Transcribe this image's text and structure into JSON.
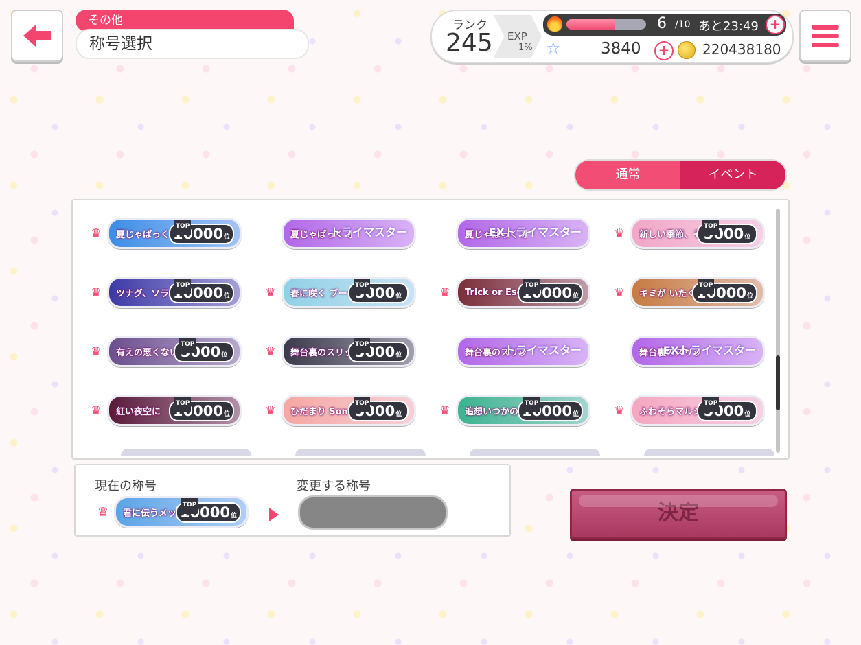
{
  "header": {
    "category": "その他",
    "title": "称号選択"
  },
  "status": {
    "rank_label": "ランク",
    "rank": "245",
    "exp_label": "EXP",
    "exp_percent": "1%",
    "exp_fraction": 0.01,
    "stamina_current": "6",
    "stamina_max": "/10",
    "stamina_timer": "あと23:49",
    "stamina_fraction": 0.6,
    "stars": "3840",
    "coins": "220438180"
  },
  "tabs": [
    "通常",
    "イベント"
  ],
  "titles": [
    {
      "name": "夏じゃぱっく 水の国",
      "rank": "10000",
      "crown": true,
      "award": "",
      "color": "#3b8de6"
    },
    {
      "name": "夏じゃぱっく 水の国",
      "rank": "",
      "crown": false,
      "award": "トライマスター",
      "color": "#b267e8"
    },
    {
      "name": "夏じゃぱっく 水の国",
      "rank": "",
      "crown": false,
      "award": "EXトライマスター",
      "color": "#b267e8"
    },
    {
      "name": "新しい季節、その前に",
      "rank": "5000",
      "crown": true,
      "award": "",
      "color": "#f2a7c6"
    },
    {
      "name": "ツナグ、ソラモヨウ",
      "rank": "10000",
      "crown": true,
      "award": "",
      "color": "#3d3aa6"
    },
    {
      "name": "春に咲く ブーケ",
      "rank": "5000",
      "crown": true,
      "award": "",
      "color": "#8fd1e6"
    },
    {
      "name": "Trick or Escape!",
      "rank": "10000",
      "crown": true,
      "award": "",
      "color": "#7a2f3a"
    },
    {
      "name": "キミが いたくらい",
      "rank": "10000",
      "crown": true,
      "award": "",
      "color": "#c77b42"
    },
    {
      "name": "有えの悪くない休日",
      "rank": "5000",
      "crown": true,
      "award": "",
      "color": "#6b4f8e"
    },
    {
      "name": "舞台裏のスリット",
      "rank": "5000",
      "crown": true,
      "award": "",
      "color": "#3a3a4a"
    },
    {
      "name": "舞台裏のスリット",
      "rank": "",
      "crown": false,
      "award": "トライマスター",
      "color": "#b267e8"
    },
    {
      "name": "舞台裏のスリット",
      "rank": "",
      "crown": false,
      "award": "EXトライマスター",
      "color": "#b267e8"
    },
    {
      "name": "紅い夜空に",
      "rank": "10000",
      "crown": true,
      "award": "",
      "color": "#5a1a3a"
    },
    {
      "name": "ひだまり Son Aforme",
      "rank": "5000",
      "crown": true,
      "award": "",
      "color": "#f5a7a2"
    },
    {
      "name": "追想いつかのクリスマス",
      "rank": "10000",
      "crown": true,
      "award": "",
      "color": "#3bb38f"
    },
    {
      "name": "ふわそらマルシェ",
      "rank": "5000",
      "crown": true,
      "award": "",
      "color": "#f5a7c0"
    }
  ],
  "current": {
    "label": "現在の称号",
    "title_name": "君に伝うメッセージ!",
    "rank": "10000",
    "color": "#5aa4e6"
  },
  "change": {
    "label": "変更する称号"
  },
  "decide_label": "決定",
  "badge_top": "TOP",
  "badge_pos": "位"
}
